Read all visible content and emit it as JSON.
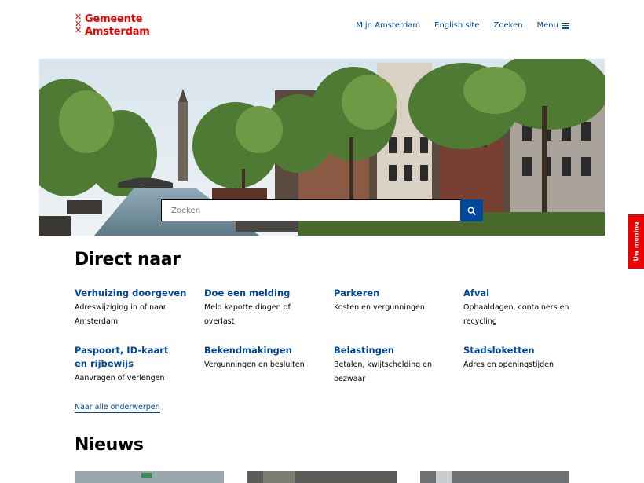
{
  "header": {
    "logo_line1": "Gemeente",
    "logo_line2": "Amsterdam",
    "nav": [
      "Mijn Amsterdam",
      "English site",
      "Zoeken",
      "Menu"
    ]
  },
  "search": {
    "placeholder": "Zoeken"
  },
  "feedback_tab": "Uw mening",
  "direct": {
    "heading": "Direct naar",
    "items": [
      {
        "title": "Verhuizing doorgeven",
        "desc": "Adreswijziging in of naar Amsterdam"
      },
      {
        "title": "Doe een melding",
        "desc": "Meld kapotte dingen of overlast"
      },
      {
        "title": "Parkeren",
        "desc": "Kosten en vergunningen"
      },
      {
        "title": "Afval",
        "desc": "Ophaaldagen, containers en recycling"
      },
      {
        "title": "Paspoort, ID-kaart en rijbewijs",
        "desc": "Aanvragen of verlengen"
      },
      {
        "title": "Bekendmakingen",
        "desc": "Vergunningen en besluiten"
      },
      {
        "title": "Belastingen",
        "desc": "Betalen, kwijtschelding en bezwaar"
      },
      {
        "title": "Stadsloketten",
        "desc": "Adres en openingstijden"
      }
    ],
    "all_link": "Naar alle onderwerpen"
  },
  "news": {
    "heading": "Nieuws"
  },
  "colors": {
    "brand_red": "#ec0000",
    "link_blue": "#004699"
  }
}
